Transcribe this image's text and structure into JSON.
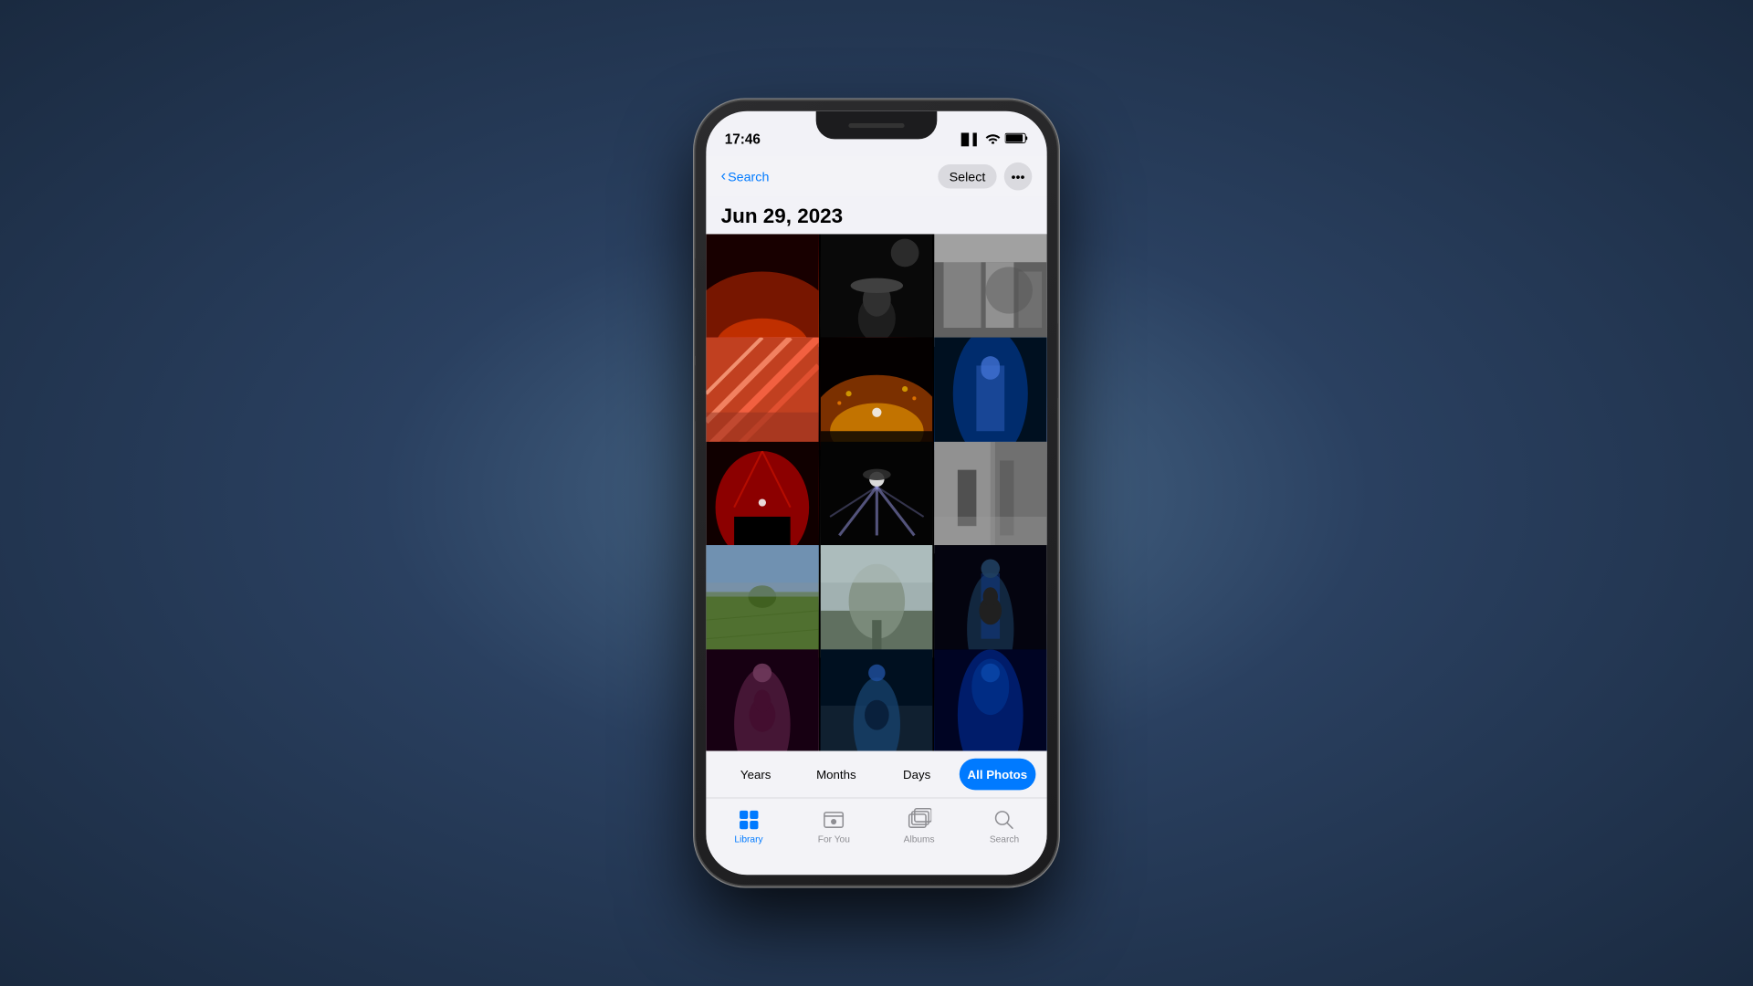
{
  "phone": {
    "status_bar": {
      "time": "17:46",
      "signal_icon": "📶",
      "wifi_icon": "wifi",
      "battery_icon": "battery"
    },
    "nav": {
      "back_label": "Search",
      "select_label": "Select",
      "more_label": "•••"
    },
    "date_header": "Jun 29, 2023",
    "photos": [
      {
        "id": 1,
        "theme": "red-stage",
        "label": "Concert red stage"
      },
      {
        "id": 2,
        "theme": "dark-hat",
        "label": "Dark performer with hat"
      },
      {
        "id": 3,
        "theme": "bw-building",
        "label": "Black and white building"
      },
      {
        "id": 4,
        "theme": "geometric",
        "label": "Geometric architecture"
      },
      {
        "id": 5,
        "theme": "concert-warm",
        "label": "Concert warm lights"
      },
      {
        "id": 6,
        "theme": "blue-performer",
        "label": "Blue lit performer"
      },
      {
        "id": 7,
        "theme": "red-concert",
        "label": "Red concert stage"
      },
      {
        "id": 8,
        "theme": "dark-concert",
        "label": "Dark concert lights"
      },
      {
        "id": 9,
        "theme": "bw-interior",
        "label": "Black and white interior"
      },
      {
        "id": 10,
        "theme": "green-field",
        "label": "Aerial green field"
      },
      {
        "id": 11,
        "theme": "misty-tree",
        "label": "Misty tree landscape"
      },
      {
        "id": 12,
        "theme": "guitarist-spotlight",
        "label": "Guitarist spotlight"
      },
      {
        "id": 13,
        "theme": "guitarist-warm",
        "label": "Female guitarist warm"
      },
      {
        "id": 14,
        "theme": "guitarist-stage",
        "label": "Guitarist on stage"
      },
      {
        "id": 15,
        "theme": "blue-performer2",
        "label": "Blue lit performer 2"
      }
    ],
    "period_tabs": [
      {
        "label": "Years",
        "active": false
      },
      {
        "label": "Months",
        "active": false
      },
      {
        "label": "Days",
        "active": false
      },
      {
        "label": "All Photos",
        "active": true
      }
    ],
    "bottom_tabs": [
      {
        "label": "Library",
        "active": true,
        "icon": "library"
      },
      {
        "label": "For You",
        "active": false,
        "icon": "for-you"
      },
      {
        "label": "Albums",
        "active": false,
        "icon": "albums"
      },
      {
        "label": "Search",
        "active": false,
        "icon": "search"
      }
    ]
  }
}
